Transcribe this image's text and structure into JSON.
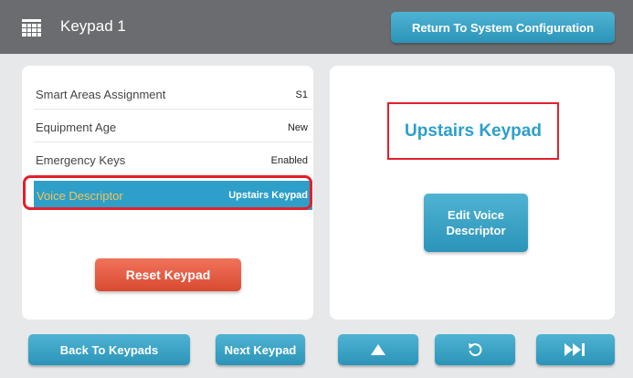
{
  "header": {
    "title": "Keypad 1",
    "return_label": "Return To System Configuration",
    "icon": "keypad-grid-icon"
  },
  "settings": {
    "rows": [
      {
        "label": "Smart Areas Assignment",
        "value": "S1"
      },
      {
        "label": "Equipment Age",
        "value": "New"
      },
      {
        "label": "Emergency Keys",
        "value": "Enabled"
      },
      {
        "label": "Voice Descriptor",
        "value": "Upstairs Keypad",
        "selected": true
      }
    ],
    "reset_label": "Reset Keypad"
  },
  "voice": {
    "title": "Upstairs Keypad",
    "edit_label": "Edit Voice\nDescriptor"
  },
  "footer": {
    "back_label": "Back To Keypads",
    "next_label": "Next Keypad",
    "up_icon": "up-arrow-icon",
    "undo_icon": "undo-icon",
    "ff_icon": "fast-forward-icon"
  },
  "colors": {
    "header_bg": "#6b6c6f",
    "accent_blue": "#2d9fc9",
    "reset_orange": "#e25a40",
    "highlight_red": "#e3202c",
    "selected_label": "#f2c45b"
  }
}
